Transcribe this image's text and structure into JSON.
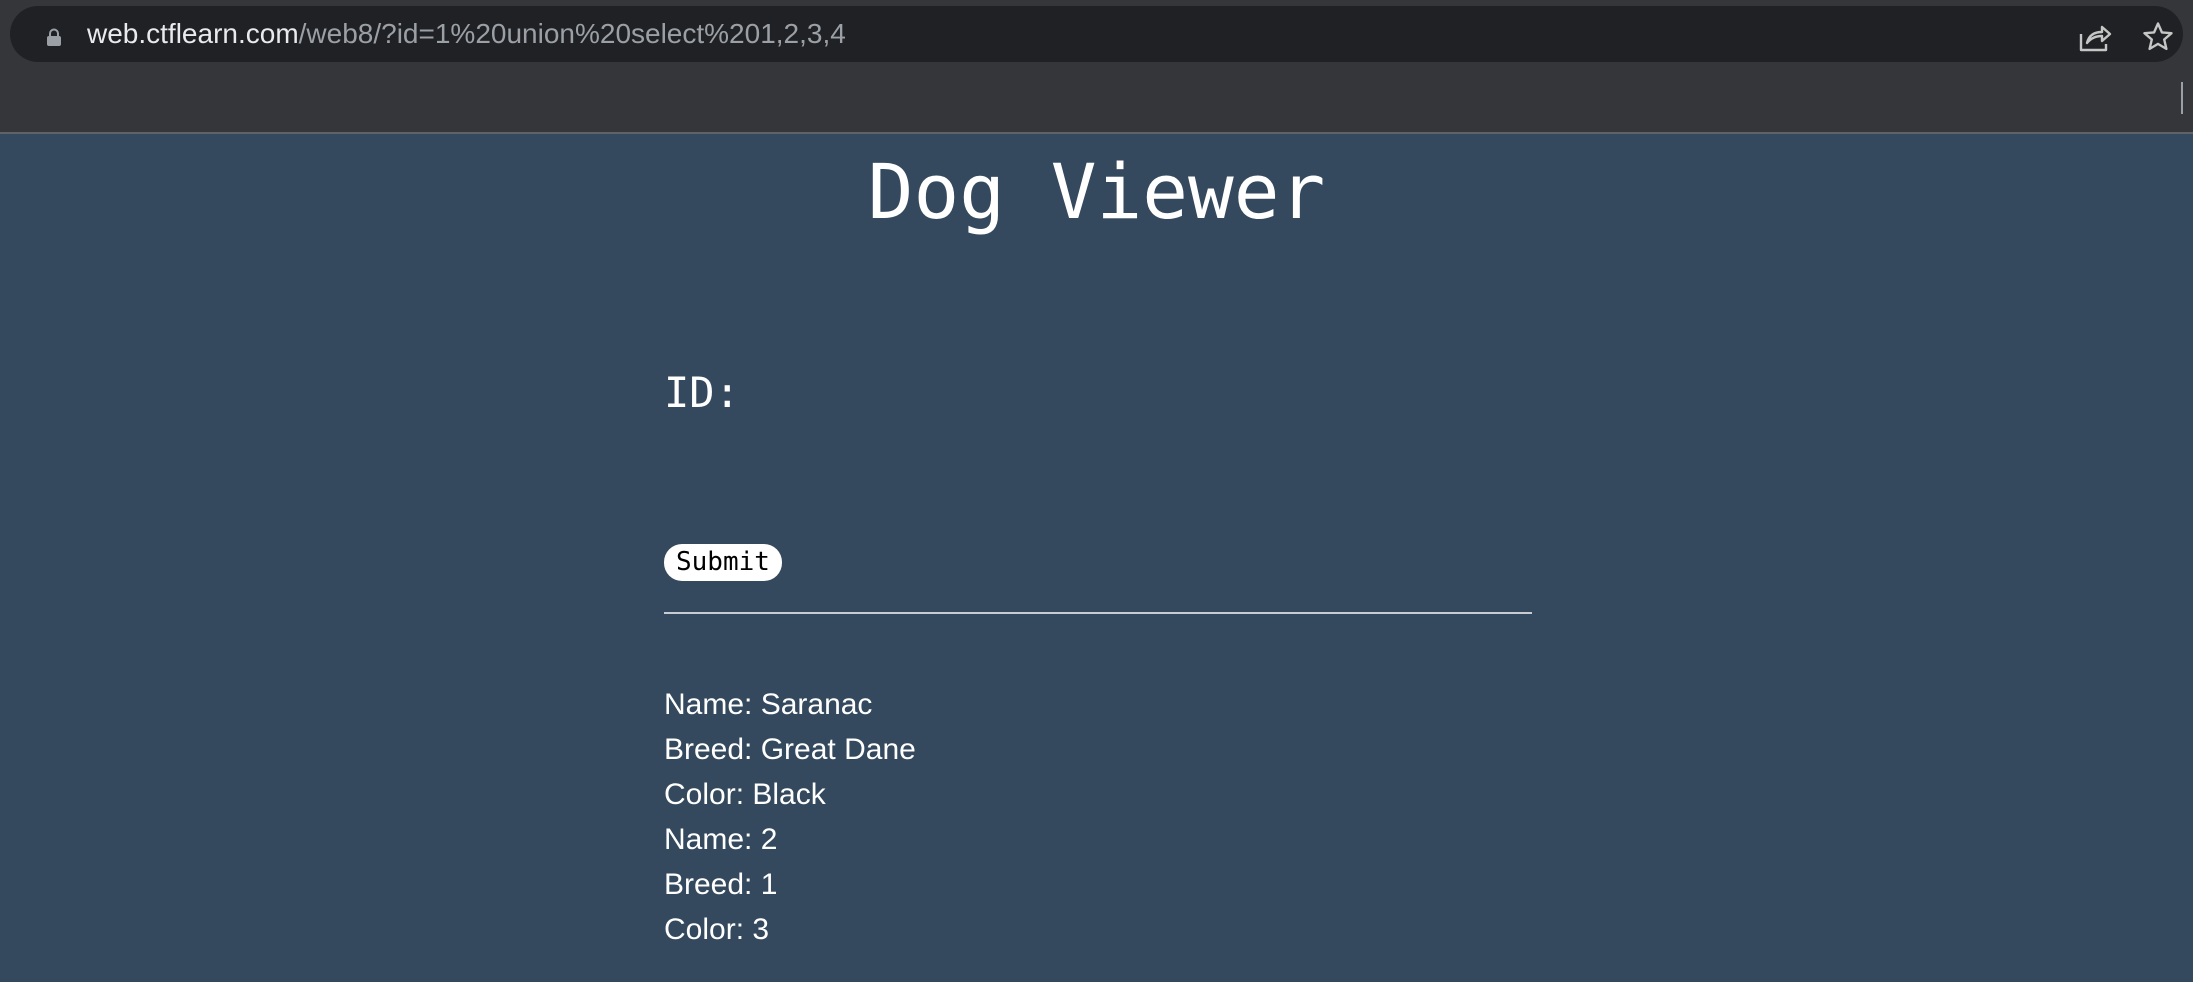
{
  "browser": {
    "url_host": "web.ctflearn.com",
    "url_path": "/web8/?id=1%20union%20select%201,2,3,4",
    "icons": {
      "lock": "lock-icon",
      "share": "share-icon",
      "bookmark": "star-icon"
    }
  },
  "page": {
    "title": "Dog Viewer",
    "id_label": "ID:",
    "id_input_value": "",
    "submit_label": "Submit",
    "results": [
      "Name: Saranac",
      "Breed: Great Dane",
      "Color: Black",
      "Name: 2",
      "Breed: 1",
      "Color: 3"
    ]
  },
  "colors": {
    "page_background": "#34495e",
    "chrome_background": "#35363a",
    "omnibox_background": "#202124",
    "text": "#ffffff"
  }
}
